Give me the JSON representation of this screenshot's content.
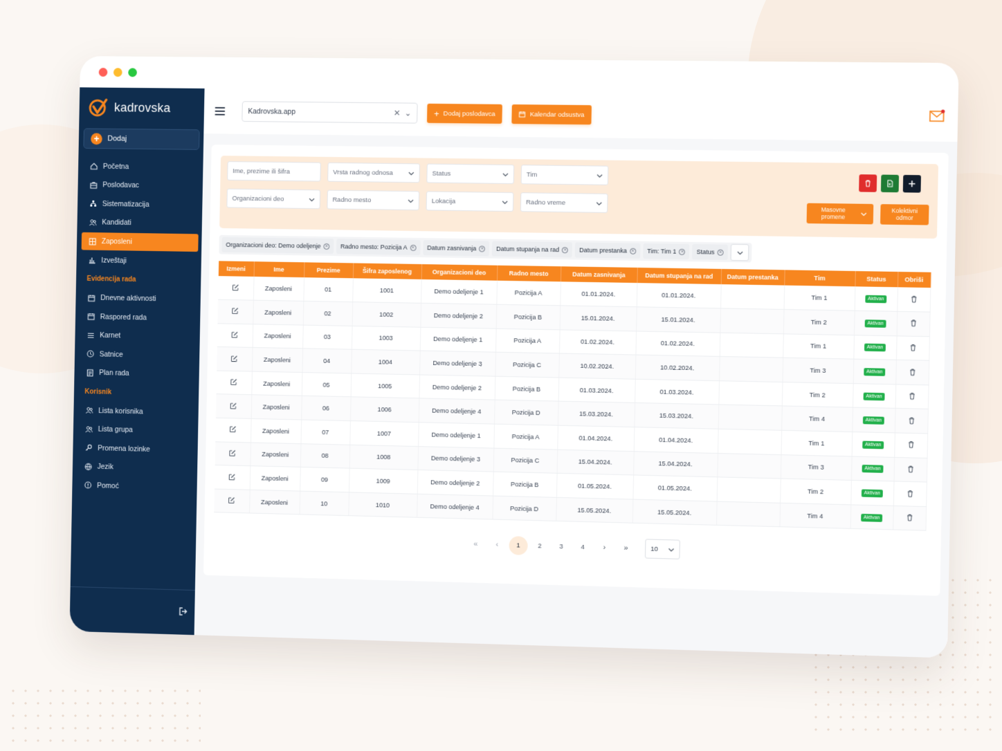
{
  "app": {
    "name": "kadrovska"
  },
  "sidebar": {
    "add_label": "Dodaj",
    "items": [
      {
        "label": "Početna",
        "icon": "home-icon"
      },
      {
        "label": "Poslodavac",
        "icon": "briefcase-icon"
      },
      {
        "label": "Sistematizacija",
        "icon": "hierarchy-icon"
      },
      {
        "label": "Kandidati",
        "icon": "users-icon"
      },
      {
        "label": "Zaposleni",
        "icon": "grid-icon",
        "active": true
      },
      {
        "label": "Izveštaji",
        "icon": "bar-chart-icon"
      }
    ],
    "section_evidencija": "Evidencija rada",
    "evidencija_items": [
      {
        "label": "Dnevne aktivnosti",
        "icon": "calendar-icon"
      },
      {
        "label": "Raspored rada",
        "icon": "calendar-icon"
      },
      {
        "label": "Karnet",
        "icon": "list-icon"
      },
      {
        "label": "Satnice",
        "icon": "clock-icon"
      },
      {
        "label": "Plan rada",
        "icon": "document-icon"
      }
    ],
    "section_korisnik": "Korisnik",
    "korisnik_items": [
      {
        "label": "Lista korisnika",
        "icon": "users-icon"
      },
      {
        "label": "Lista grupa",
        "icon": "users-icon"
      },
      {
        "label": "Promena lozinke",
        "icon": "key-icon"
      },
      {
        "label": "Jezik",
        "icon": "globe-icon"
      },
      {
        "label": "Pomoć",
        "icon": "help-icon"
      }
    ]
  },
  "topbar": {
    "org_value": "Kadrovska.app",
    "add_employer_label": "Dodaj poslodavca",
    "calendar_label": "Kalendar odsustva"
  },
  "filters": {
    "search_placeholder": "Ime, prezime ili šifra",
    "employment_type": "Vrsta radnog odnosa",
    "status": "Status",
    "team": "Tim",
    "org_unit": "Organizacioni deo",
    "position": "Radno mesto",
    "location": "Lokacija",
    "work_time": "Radno vreme",
    "mass_changes": "Masovne promene",
    "collective_leave": "Kolektivni odmor"
  },
  "chips": [
    "Organizacioni deo: Demo odeljenje",
    "Radno mesto: Pozicija A",
    "Datum zasnivanja",
    "Datum stupanja na rad",
    "Datum prestanka",
    "Tim: Tim 1",
    "Status"
  ],
  "table": {
    "columns": [
      "Izmeni",
      "Ime",
      "Prezime",
      "Šifra zaposlenog",
      "Organizacioni deo",
      "Radno mesto",
      "Datum zasnivanja",
      "Datum stupanja na rad",
      "Datum prestanka",
      "Tim",
      "Status",
      "Obriši"
    ],
    "rows": [
      [
        "Zaposleni",
        "01",
        "1001",
        "Demo odeljenje 1",
        "Pozicija A",
        "01.01.2024.",
        "01.01.2024.",
        "",
        "Tim 1",
        "Aktivan"
      ],
      [
        "Zaposleni",
        "02",
        "1002",
        "Demo odeljenje 2",
        "Pozicija B",
        "15.01.2024.",
        "15.01.2024.",
        "",
        "Tim 2",
        "Aktivan"
      ],
      [
        "Zaposleni",
        "03",
        "1003",
        "Demo odeljenje 1",
        "Pozicija A",
        "01.02.2024.",
        "01.02.2024.",
        "",
        "Tim 1",
        "Aktivan"
      ],
      [
        "Zaposleni",
        "04",
        "1004",
        "Demo odeljenje 3",
        "Pozicija C",
        "10.02.2024.",
        "10.02.2024.",
        "",
        "Tim 3",
        "Aktivan"
      ],
      [
        "Zaposleni",
        "05",
        "1005",
        "Demo odeljenje 2",
        "Pozicija B",
        "01.03.2024.",
        "01.03.2024.",
        "",
        "Tim 2",
        "Aktivan"
      ],
      [
        "Zaposleni",
        "06",
        "1006",
        "Demo odeljenje 4",
        "Pozicija D",
        "15.03.2024.",
        "15.03.2024.",
        "",
        "Tim 4",
        "Aktivan"
      ],
      [
        "Zaposleni",
        "07",
        "1007",
        "Demo odeljenje 1",
        "Pozicija A",
        "01.04.2024.",
        "01.04.2024.",
        "",
        "Tim 1",
        "Aktivan"
      ],
      [
        "Zaposleni",
        "08",
        "1008",
        "Demo odeljenje 3",
        "Pozicija C",
        "15.04.2024.",
        "15.04.2024.",
        "",
        "Tim 3",
        "Aktivan"
      ],
      [
        "Zaposleni",
        "09",
        "1009",
        "Demo odeljenje 2",
        "Pozicija B",
        "01.05.2024.",
        "01.05.2024.",
        "",
        "Tim 2",
        "Aktivan"
      ],
      [
        "Zaposleni",
        "10",
        "1010",
        "Demo odeljenje 4",
        "Pozicija D",
        "15.05.2024.",
        "15.05.2024.",
        "",
        "Tim 4",
        "Aktivan"
      ]
    ]
  },
  "pagination": {
    "first": "«",
    "prev": "‹",
    "pages": [
      "1",
      "2",
      "3",
      "4"
    ],
    "next": "›",
    "last": "»",
    "current": "1",
    "page_size": "10"
  },
  "colors": {
    "accent": "#f7861f",
    "sidebar": "#0f2d4e",
    "success": "#22b04b",
    "danger": "#e02d2d",
    "excel": "#1e7b34",
    "dark": "#111c2b"
  }
}
